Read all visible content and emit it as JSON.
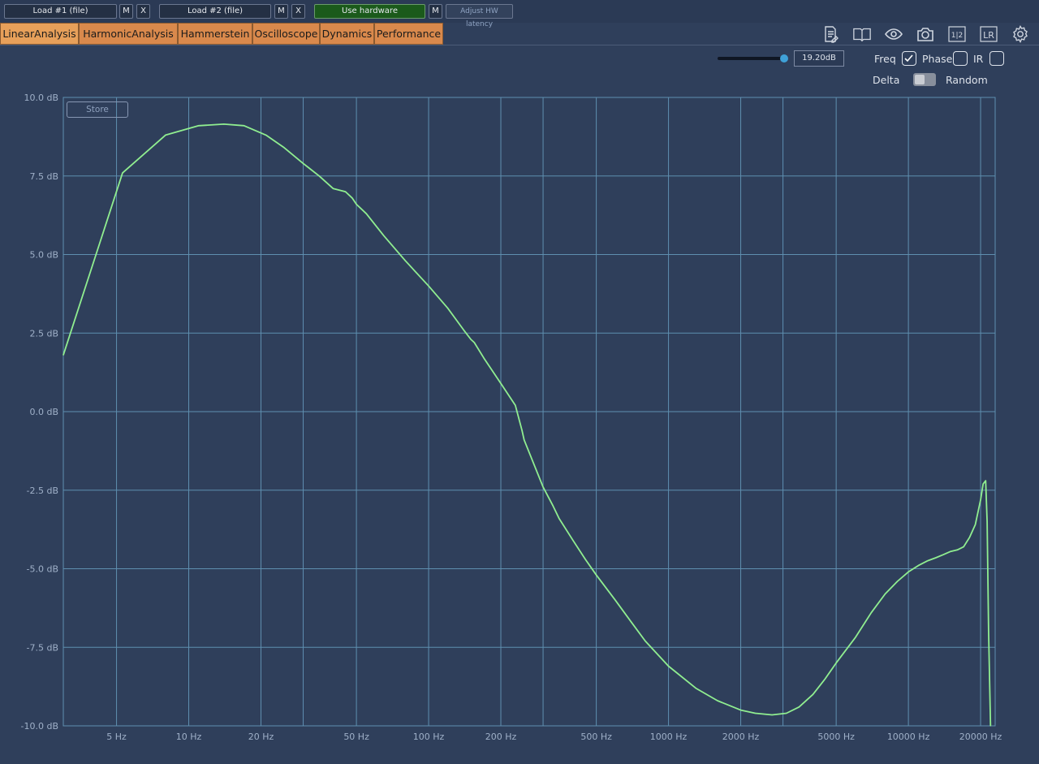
{
  "toolbar": {
    "load1_label": "Load #1 (file)",
    "load1_m": "M",
    "load1_x": "X",
    "load2_label": "Load #2 (file)",
    "load2_m": "M",
    "load2_x": "X",
    "hardware_label": "Use hardware",
    "hardware_m": "M",
    "latency_label": "Adjust HW latency"
  },
  "tabs": [
    {
      "label": "LinearAnalysis",
      "active": true
    },
    {
      "label": "HarmonicAnalysis",
      "active": false
    },
    {
      "label": "Hammerstein",
      "active": false
    },
    {
      "label": "Oscilloscope",
      "active": false
    },
    {
      "label": "Dynamics",
      "active": false
    },
    {
      "label": "Performance",
      "active": false
    }
  ],
  "icons": [
    "notes-icon",
    "book-icon",
    "eye-icon",
    "camera-icon",
    "split-1-2-icon",
    "lr-icon",
    "gear-icon"
  ],
  "icon_text": {
    "split": "1|2",
    "lr": "LR"
  },
  "controls": {
    "level_value": "19.20dB",
    "level_fraction": 1.0,
    "freq_label": "Freq",
    "freq_checked": true,
    "phase_label": "Phase",
    "phase_checked": false,
    "ir_label": "IR",
    "ir_checked": false,
    "delta_label": "Delta",
    "random_label": "Random",
    "toggle_state": "delta"
  },
  "store_label": "Store",
  "colors": {
    "background": "#2f3f5b",
    "grid": "#5f8fb0",
    "curve": "#90ee90",
    "tab": "#d9894c",
    "hardware": "#1b5a1b",
    "slider": "#3fa1d8"
  },
  "chart_data": {
    "type": "line",
    "xscale": "log",
    "xlim": [
      3,
      23000
    ],
    "ylim": [
      -10,
      10
    ],
    "grid": true,
    "y_ticks": [
      10,
      7.5,
      5,
      2.5,
      0,
      -2.5,
      -5,
      -7.5,
      -10
    ],
    "y_tick_labels": [
      "10.0 dB",
      "7.5 dB",
      "5.0 dB",
      "2.5 dB",
      "0.0 dB",
      "-2.5 dB",
      "-5.0 dB",
      "-7.5 dB",
      "-10.0 dB"
    ],
    "x_ticks": [
      5,
      10,
      20,
      50,
      100,
      200,
      500,
      1000,
      2000,
      5000,
      10000,
      20000
    ],
    "x_tick_labels": [
      "5 Hz",
      "10 Hz",
      "20 Hz",
      "50 Hz",
      "100 Hz",
      "200 Hz",
      "500 Hz",
      "1000 Hz",
      "2000 Hz",
      "5000 Hz",
      "10000 Hz",
      "20000 Hz"
    ],
    "x_minor_grid": [
      3,
      30,
      300,
      3000
    ],
    "series": [
      {
        "x": [
          3,
          5.3,
          8,
          11,
          14,
          17,
          21,
          25,
          30,
          35,
          40,
          45,
          48,
          50,
          55,
          65,
          80,
          100,
          120,
          140,
          150,
          155,
          170,
          200,
          230,
          245,
          250,
          300,
          330,
          350,
          400,
          450,
          500,
          600,
          700,
          800,
          1000,
          1300,
          1600,
          2000,
          2300,
          2700,
          3100,
          3500,
          4000,
          4500,
          5000,
          6000,
          7000,
          8000,
          9000,
          10000,
          11000,
          12000,
          13000,
          14000,
          15000,
          16000,
          17000,
          18000,
          19000,
          20000,
          20500,
          21000,
          21300,
          21600,
          22000
        ],
        "y": [
          1.8,
          7.6,
          8.8,
          9.1,
          9.15,
          9.1,
          8.8,
          8.4,
          7.9,
          7.5,
          7.1,
          7.0,
          6.8,
          6.6,
          6.3,
          5.6,
          4.8,
          4.0,
          3.3,
          2.6,
          2.3,
          2.2,
          1.7,
          0.9,
          0.2,
          -0.6,
          -0.9,
          -2.4,
          -3.0,
          -3.4,
          -4.1,
          -4.7,
          -5.2,
          -6.0,
          -6.7,
          -7.3,
          -8.1,
          -8.8,
          -9.2,
          -9.5,
          -9.6,
          -9.65,
          -9.6,
          -9.4,
          -9.0,
          -8.5,
          -8.0,
          -7.2,
          -6.4,
          -5.8,
          -5.4,
          -5.1,
          -4.9,
          -4.75,
          -4.65,
          -4.55,
          -4.45,
          -4.4,
          -4.3,
          -4.0,
          -3.6,
          -2.8,
          -2.3,
          -2.2,
          -3.5,
          -7.0,
          -10.0
        ]
      }
    ]
  }
}
